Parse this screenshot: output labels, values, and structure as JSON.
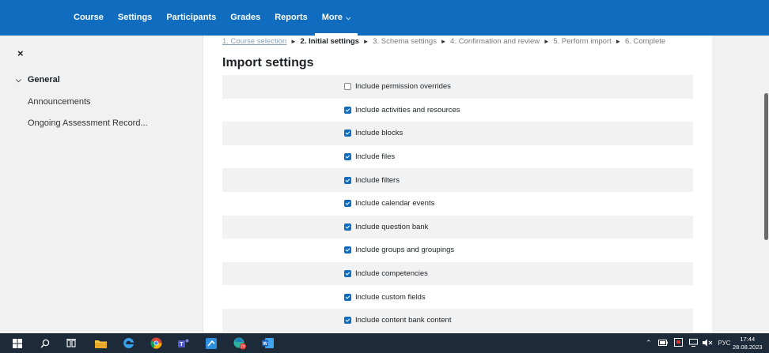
{
  "nav": {
    "items": [
      {
        "label": "Course"
      },
      {
        "label": "Settings"
      },
      {
        "label": "Participants"
      },
      {
        "label": "Grades"
      },
      {
        "label": "Reports"
      }
    ],
    "more_label": "More"
  },
  "drawer": {
    "close_icon": "×",
    "section_label": "General",
    "links": [
      "Announcements",
      "Ongoing Assessment Record..."
    ]
  },
  "breadcrumb": {
    "step1": "1. Course selection",
    "step2": "2. Initial settings",
    "step3": "3. Schema settings",
    "step4": "4. Confirmation and review",
    "step5": "5. Perform import",
    "step6": "6. Complete",
    "separator": "►"
  },
  "page_title": "Import settings",
  "settings": [
    {
      "label": "Include permission overrides",
      "checked": false
    },
    {
      "label": "Include activities and resources",
      "checked": true
    },
    {
      "label": "Include blocks",
      "checked": true
    },
    {
      "label": "Include files",
      "checked": true
    },
    {
      "label": "Include filters",
      "checked": true
    },
    {
      "label": "Include calendar events",
      "checked": true
    },
    {
      "label": "Include question bank",
      "checked": true
    },
    {
      "label": "Include groups and groupings",
      "checked": true
    },
    {
      "label": "Include competencies",
      "checked": true
    },
    {
      "label": "Include custom fields",
      "checked": true
    },
    {
      "label": "Include content bank content",
      "checked": true
    }
  ],
  "taskbar": {
    "edge_badge": "29",
    "language": "РУС",
    "time": "17:44",
    "date": "28.08.2023"
  },
  "colors": {
    "brand": "#0f6cbf",
    "taskbar": "#1c2a3a"
  }
}
